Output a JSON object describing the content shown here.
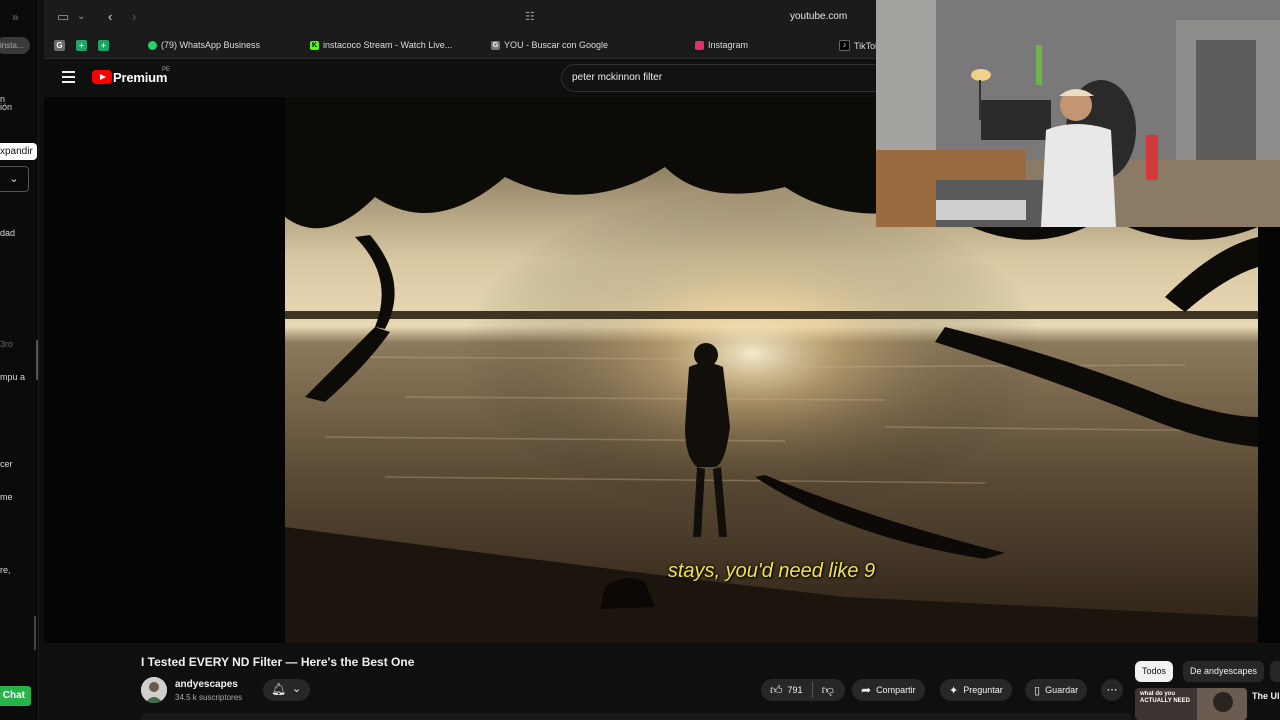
{
  "browser": {
    "url": "youtube.com",
    "bookmarks": [
      {
        "label": "(79) WhatsApp Business",
        "icon": "whatsapp-icon",
        "color": "#25d366"
      },
      {
        "label": "instacoco Stream - Watch Live...",
        "icon": "kick-icon",
        "color": "#53fc18"
      },
      {
        "label": "YOU - Buscar con Google",
        "icon": "google-icon",
        "color": "#888888"
      },
      {
        "label": "Instagram",
        "icon": "instagram-icon",
        "color": "#e1306c"
      },
      {
        "label": "TikTok",
        "icon": "tiktok-icon",
        "color": "#000000"
      }
    ]
  },
  "left_app": {
    "search_placeholder": "insta...",
    "tooltip": "xpandir",
    "fragments": [
      "n",
      "ión",
      "dad",
      "3ro",
      "mpu a",
      "cer",
      "me",
      "re,"
    ],
    "chat_label": "Chat"
  },
  "youtube": {
    "brand": "Premium",
    "country": "PE",
    "search_query": "peter mckinnon filter",
    "subtitle": "stays, you'd need like 9",
    "video_title": "I Tested EVERY ND Filter — Here's the Best One",
    "channel_name": "andyescapes",
    "subscribers": "34.5 k suscriptores",
    "likes": "791",
    "share_label": "Compartir",
    "ask_label": "Preguntar",
    "save_label": "Guardar",
    "chips": [
      "Todos",
      "De andyescapes"
    ],
    "rec_title": "The Ul... Solo C...",
    "rec_thumb_text": "what do you ACTUALLY NEED"
  },
  "colors": {
    "brand_red": "#ff0000",
    "subtitle_yellow": "#f2e24a",
    "chat_green": "#27b34a"
  }
}
